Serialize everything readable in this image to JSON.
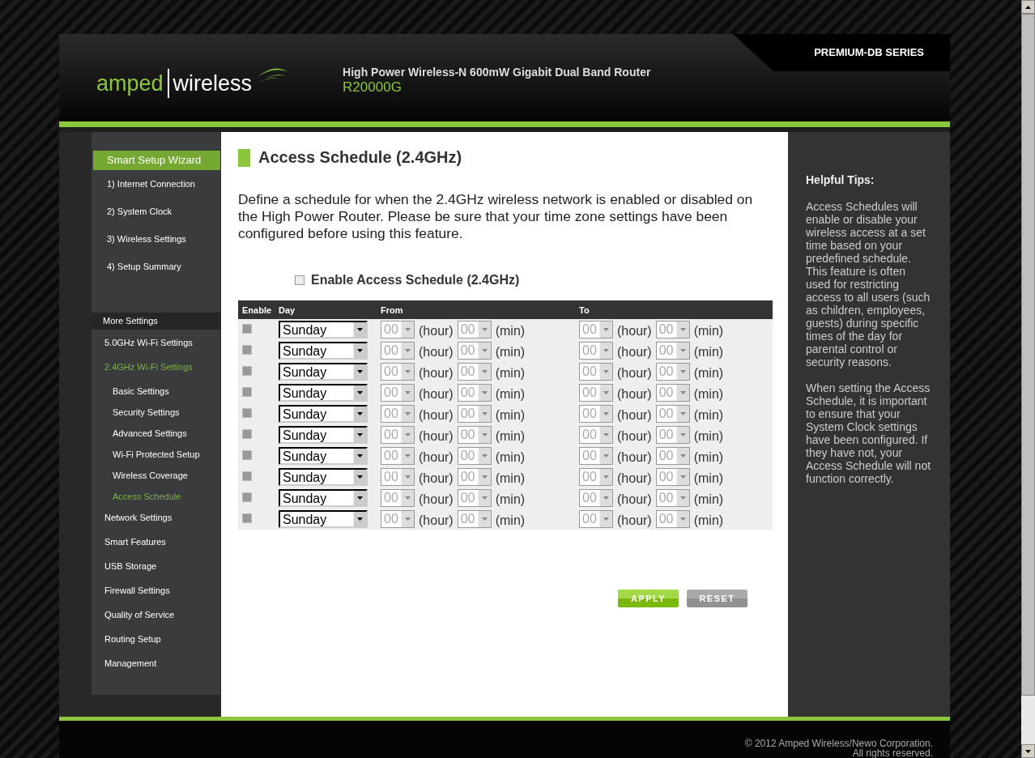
{
  "header": {
    "logo": {
      "left": "amped",
      "right": "wireless"
    },
    "product_title": "High Power Wireless-N 600mW Gigabit Dual Band Router",
    "model": "R20000G",
    "series": "PREMIUM-DB SERIES"
  },
  "sidebar": {
    "wizard": {
      "title": "Smart Setup Wizard",
      "items": [
        {
          "label": "1) Internet Connection",
          "selected": false
        },
        {
          "label": "2) System Clock",
          "selected": false
        },
        {
          "label": "3) Wireless Settings",
          "selected": false
        },
        {
          "label": "4) Setup Summary",
          "selected": false
        }
      ]
    },
    "more_title": "More Settings",
    "items": [
      {
        "label": "5.0GHz Wi-Fi Settings",
        "selected": false
      },
      {
        "label": "2.4GHz Wi-Fi Settings",
        "selected": true,
        "children": [
          {
            "label": "Basic Settings",
            "selected": false
          },
          {
            "label": "Security Settings",
            "selected": false
          },
          {
            "label": "Advanced Settings",
            "selected": false
          },
          {
            "label": "Wi-Fi Protected Setup",
            "selected": false
          },
          {
            "label": "Wireless Coverage",
            "selected": false
          },
          {
            "label": "Access Schedule",
            "selected": true
          }
        ]
      },
      {
        "label": "Network Settings",
        "selected": false
      },
      {
        "label": "Smart Features",
        "selected": false
      },
      {
        "label": "USB Storage",
        "selected": false
      },
      {
        "label": "Firewall Settings",
        "selected": false
      },
      {
        "label": "Quality of Service",
        "selected": false
      },
      {
        "label": "Routing Setup",
        "selected": false
      },
      {
        "label": "Management",
        "selected": false
      }
    ]
  },
  "content": {
    "title": "Access Schedule (2.4GHz)",
    "description": "Define a schedule for when the 2.4GHz wireless network is enabled or disabled on the High Power Router. Please be sure that your time zone settings have been configured before using this feature.",
    "enable_schedule": {
      "label": "Enable Access Schedule (2.4GHz)",
      "checked": false
    },
    "table": {
      "columns": [
        "Enable",
        "Day",
        "From",
        "To"
      ],
      "rows": [
        {
          "checked": false,
          "disabled": true,
          "day": "Sunday",
          "from_hour": "00",
          "from_hour_unit": "(hour)",
          "from_min": "00",
          "from_min_unit": "(min)",
          "to_hour": "00",
          "to_hour_unit": "(hour)",
          "to_min": "00",
          "to_min_unit": "(min)"
        },
        {
          "checked": false,
          "disabled": true,
          "day": "Sunday",
          "from_hour": "00",
          "from_hour_unit": "(hour)",
          "from_min": "00",
          "from_min_unit": "(min)",
          "to_hour": "00",
          "to_hour_unit": "(hour)",
          "to_min": "00",
          "to_min_unit": "(min)"
        },
        {
          "checked": false,
          "disabled": true,
          "day": "Sunday",
          "from_hour": "00",
          "from_hour_unit": "(hour)",
          "from_min": "00",
          "from_min_unit": "(min)",
          "to_hour": "00",
          "to_hour_unit": "(hour)",
          "to_min": "00",
          "to_min_unit": "(min)"
        },
        {
          "checked": false,
          "disabled": true,
          "day": "Sunday",
          "from_hour": "00",
          "from_hour_unit": "(hour)",
          "from_min": "00",
          "from_min_unit": "(min)",
          "to_hour": "00",
          "to_hour_unit": "(hour)",
          "to_min": "00",
          "to_min_unit": "(min)"
        },
        {
          "checked": false,
          "disabled": true,
          "day": "Sunday",
          "from_hour": "00",
          "from_hour_unit": "(hour)",
          "from_min": "00",
          "from_min_unit": "(min)",
          "to_hour": "00",
          "to_hour_unit": "(hour)",
          "to_min": "00",
          "to_min_unit": "(min)"
        },
        {
          "checked": false,
          "disabled": true,
          "day": "Sunday",
          "from_hour": "00",
          "from_hour_unit": "(hour)",
          "from_min": "00",
          "from_min_unit": "(min)",
          "to_hour": "00",
          "to_hour_unit": "(hour)",
          "to_min": "00",
          "to_min_unit": "(min)"
        },
        {
          "checked": false,
          "disabled": true,
          "day": "Sunday",
          "from_hour": "00",
          "from_hour_unit": "(hour)",
          "from_min": "00",
          "from_min_unit": "(min)",
          "to_hour": "00",
          "to_hour_unit": "(hour)",
          "to_min": "00",
          "to_min_unit": "(min)"
        },
        {
          "checked": false,
          "disabled": true,
          "day": "Sunday",
          "from_hour": "00",
          "from_hour_unit": "(hour)",
          "from_min": "00",
          "from_min_unit": "(min)",
          "to_hour": "00",
          "to_hour_unit": "(hour)",
          "to_min": "00",
          "to_min_unit": "(min)"
        },
        {
          "checked": false,
          "disabled": true,
          "day": "Sunday",
          "from_hour": "00",
          "from_hour_unit": "(hour)",
          "from_min": "00",
          "from_min_unit": "(min)",
          "to_hour": "00",
          "to_hour_unit": "(hour)",
          "to_min": "00",
          "to_min_unit": "(min)"
        },
        {
          "checked": false,
          "disabled": true,
          "day": "Sunday",
          "from_hour": "00",
          "from_hour_unit": "(hour)",
          "from_min": "00",
          "from_min_unit": "(min)",
          "to_hour": "00",
          "to_hour_unit": "(hour)",
          "to_min": "00",
          "to_min_unit": "(min)"
        }
      ]
    },
    "buttons": [
      {
        "label": "APPLY",
        "kind": "primary"
      },
      {
        "label": "RESET",
        "kind": "secondary"
      }
    ]
  },
  "tips": {
    "title": "Helpful Tips:",
    "paragraphs": [
      "Access Schedules will enable or disable your wireless access at a set time based on your predefined schedule. This feature is often used for restricting access to all users (such as children, employees, guests) during specific times of the day for parental control or security reasons.",
      "When setting the Access Schedule, it is important to ensure that your System Clock settings have been configured. If they have not, your Access Schedule will not function correctly."
    ]
  },
  "footer": {
    "lines": [
      "© 2012 Amped Wireless/Newo Corporation.",
      "All rights reserved."
    ]
  }
}
